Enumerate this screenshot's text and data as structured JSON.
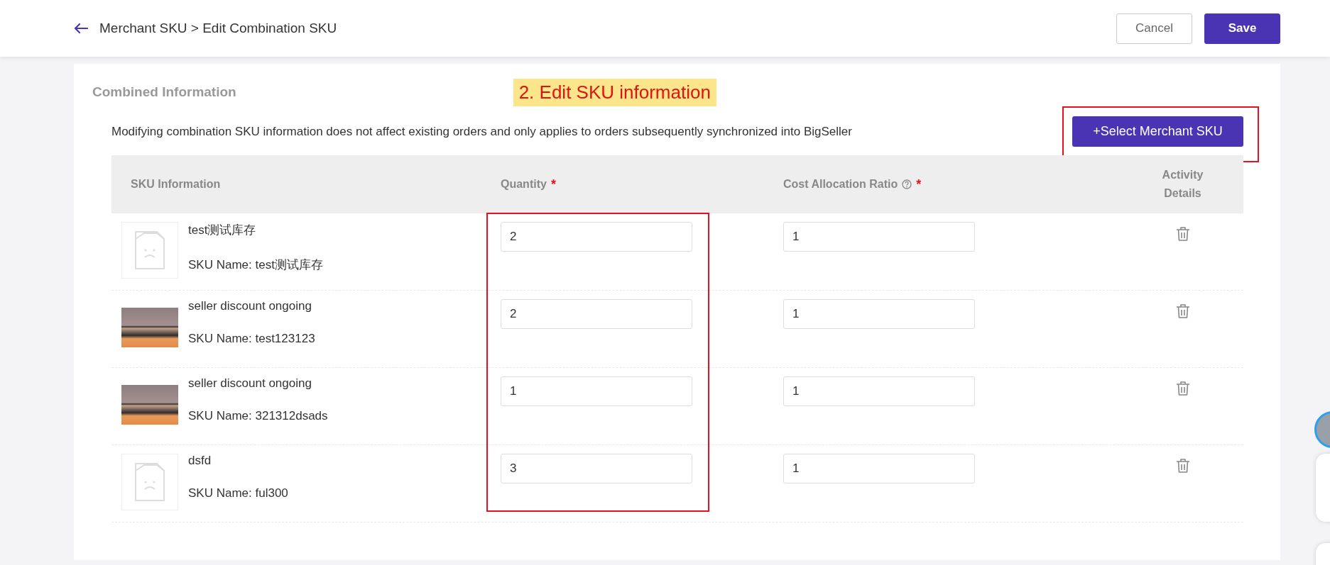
{
  "header": {
    "breadcrumb": "Merchant SKU > Edit Combination SKU",
    "buttons": [
      {
        "label": "Cancel",
        "kind": "secondary"
      },
      {
        "label": "Save",
        "kind": "primary"
      }
    ]
  },
  "section": {
    "title": "Combined Information",
    "annotation": "2. Edit SKU information",
    "notice": "Modifying combination SKU information does not affect existing orders and only applies to orders subsequently synchronized into BigSeller",
    "action_button": "+Select Merchant SKU"
  },
  "table": {
    "columns": [
      {
        "label": "SKU Information",
        "help": false
      },
      {
        "label": "Quantity",
        "help": false,
        "required_mark": "*"
      },
      {
        "label": "Cost Allocation Ratio",
        "help": true,
        "required_mark": "*"
      },
      {
        "label": "Activity Details",
        "help": false
      }
    ],
    "rows": [
      {
        "title": "test测试库存",
        "sku_name": "SKU Name: test测试库存",
        "kind": "no_image",
        "quantity": "2",
        "ratio": "1"
      },
      {
        "title": "seller discount ongoing",
        "sku_name": "SKU Name: test123123",
        "kind": "photo",
        "quantity": "2",
        "ratio": "1"
      },
      {
        "title": "seller discount ongoing",
        "sku_name": "SKU Name: 321312dsads",
        "kind": "photo",
        "quantity": "1",
        "ratio": "1"
      },
      {
        "title": "dsfd",
        "sku_name": "SKU Name: ful300",
        "kind": "no_image",
        "quantity": "3",
        "ratio": "1"
      }
    ]
  }
}
